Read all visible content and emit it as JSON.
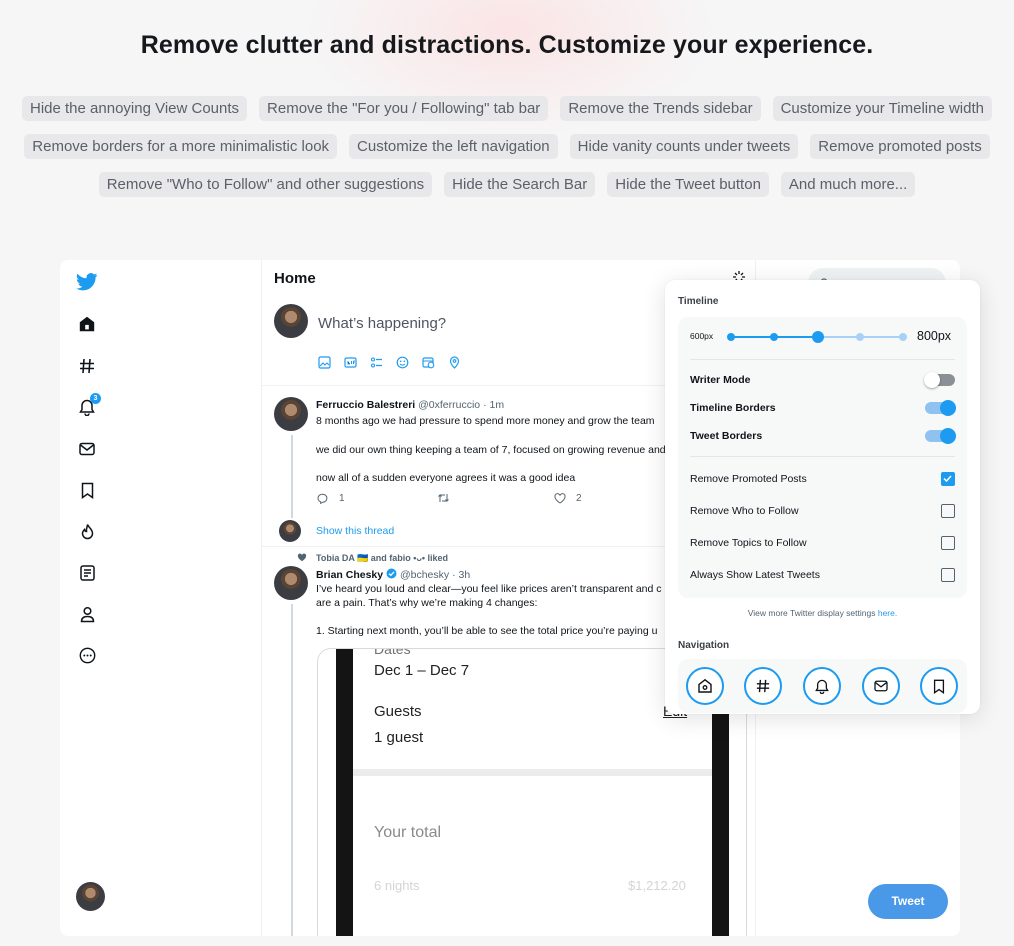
{
  "headline": "Remove clutter and distractions. Customize your experience.",
  "features": [
    [
      "Hide the annoying View Counts",
      "Remove the \"For you / Following\" tab bar",
      "Remove the Trends sidebar",
      "Customize your Timeline width"
    ],
    [
      "Remove borders for a more minimalistic look",
      "Customize the left navigation",
      "Hide vanity counts under tweets",
      "Remove promoted posts"
    ],
    [
      "Remove \"Who to Follow\" and other suggestions",
      "Hide the Search Bar",
      "Hide the Tweet button",
      "And much more..."
    ]
  ],
  "twitter": {
    "left_nav": {
      "items": [
        "twitter-logo-icon",
        "home-icon",
        "hashtag-icon",
        "bell-icon",
        "mail-icon",
        "bookmark-icon",
        "fire-icon",
        "list-icon",
        "person-icon",
        "more-icon"
      ],
      "notification_count": "3"
    },
    "header": {
      "title": "Home"
    },
    "compose": {
      "placeholder": "What’s happening?"
    },
    "tweet1": {
      "name": "Ferruccio Balestreri",
      "handle": "@0xferruccio · 1m",
      "lines": [
        "8 months ago we had pressure to spend more money and grow the team",
        "we did our own thing keeping a team of 7, focused on growing revenue and",
        "now all of a sudden everyone agrees it was a good idea"
      ],
      "replies": "1",
      "likes": "2",
      "thread_link": "Show this thread"
    },
    "tweet2": {
      "liked_by": "Tobia DA 🇺🇦 and fabio •ᴗ• liked",
      "name": "Brian Chesky",
      "handle": "@bchesky · 3h",
      "lines": [
        "I’ve heard you loud and clear—you feel like prices aren’t transparent and c",
        "are a pain. That’s why we’re making 4 changes:",
        "1. Starting next month, you’ll be able to see the total price you’re paying u"
      ],
      "media": {
        "dates_label": "Dates",
        "dates_value": "Dec 1 – Dec 7",
        "guests_label": "Guests",
        "guests_value": "1 guest",
        "edit_label": "Edit",
        "total_label": "Your total",
        "nights_label": "6 nights",
        "nights_price": "$1,212.20"
      }
    },
    "tweet_button": "Tweet"
  },
  "settings_panel": {
    "timeline_label": "Timeline",
    "slider": {
      "min_label": "600px",
      "value_label": "800px",
      "stops": 5,
      "selected_stop": 2
    },
    "toggles": [
      {
        "label": "Writer Mode",
        "on": false
      },
      {
        "label": "Timeline Borders",
        "on": true
      },
      {
        "label": "Tweet Borders",
        "on": true
      }
    ],
    "checkboxes": [
      {
        "label": "Remove Promoted Posts",
        "checked": true
      },
      {
        "label": "Remove Who to Follow",
        "checked": false
      },
      {
        "label": "Remove Topics to Follow",
        "checked": false
      },
      {
        "label": "Always Show Latest Tweets",
        "checked": false
      }
    ],
    "footer_text": "View more Twitter display settings ",
    "footer_link": "here.",
    "navigation_label": "Navigation",
    "nav_buttons": [
      "home-icon",
      "hashtag-icon",
      "bell-icon",
      "mail-icon",
      "bookmark-icon"
    ]
  },
  "colors": {
    "accent": "#1d9bf0",
    "tweet_button": "#4a99e9",
    "page_bg": "#f6f6f7",
    "pill_bg": "#e8e8ea"
  }
}
